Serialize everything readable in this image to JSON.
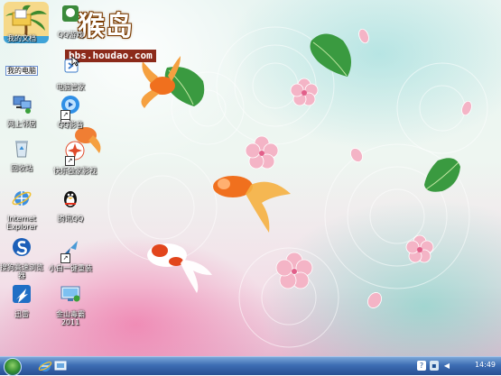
{
  "watermark": {
    "site_name": "猴岛",
    "url": "bbs.houdao.com"
  },
  "desktop": {
    "icons": [
      {
        "label": "我的文档",
        "icon": "documents-folder-icon"
      },
      {
        "label": "我的电脑",
        "icon": "computer-icon"
      },
      {
        "label": "网上邻居",
        "icon": "network-icon"
      },
      {
        "label": "回收站",
        "icon": "recycle-bin-icon"
      },
      {
        "label": "Internet Explorer",
        "icon": "internet-explorer-icon"
      },
      {
        "label": "搜狗高速浏览器",
        "icon": "sogou-browser-icon"
      },
      {
        "label": "迅雷",
        "icon": "xunlei-icon"
      },
      {
        "label": "QQ游戏",
        "icon": "qq-game-icon"
      },
      {
        "label": "电脑管家",
        "icon": "pc-manager-icon"
      },
      {
        "label": "QQ影音",
        "icon": "qq-player-icon"
      },
      {
        "label": "快乐独家影视",
        "icon": "video-app-icon"
      },
      {
        "label": "腾讯QQ",
        "icon": "qq-penguin-icon"
      },
      {
        "label": "小白一键重装",
        "icon": "reinstall-tool-icon"
      },
      {
        "label": "金山毒霸2011",
        "icon": "jinshan-antivirus-icon"
      }
    ]
  },
  "taskbar": {
    "clock": "14:49",
    "quick_launch": [
      "internet-explorer-icon",
      "show-desktop-icon"
    ],
    "tray": [
      "help-icon",
      "network-tray-icon",
      "volume-icon"
    ]
  },
  "colors": {
    "taskbar": "#3d6db3",
    "selection_border": "#6a8fd0",
    "fish": "#f0701e",
    "leaf": "#3a9a40",
    "blossom": "#f4b4c6"
  }
}
